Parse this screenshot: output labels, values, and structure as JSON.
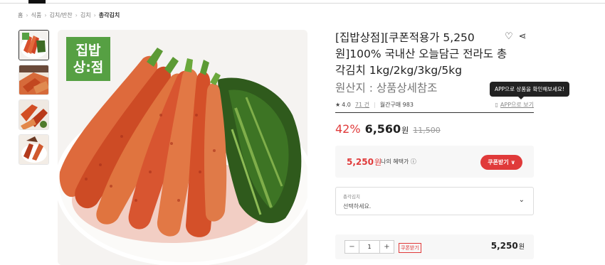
{
  "breadcrumb": [
    "홈",
    "식품",
    "김치/반찬",
    "김치",
    "총각김치"
  ],
  "brand_badge": {
    "line1": "집밥",
    "line2": "상:점"
  },
  "product": {
    "title": "[집밥상점][쿠폰적용가 5,250원]100% 국내산 오늘담근 전라도 총각김치 1kg/2kg/3kg/5kg",
    "origin": "원산지 : 상품상세참조"
  },
  "icons": {
    "wish": "heart-icon",
    "share": "share-icon",
    "star": "star-icon",
    "mobile": "mobile-icon"
  },
  "meta": {
    "rating": "4.0",
    "review_count": "71 건",
    "monthly_sales": "월간구매 983",
    "app_link": "APP으로 보기"
  },
  "tooltip": "APP으로 상품을 확인해보세요!",
  "price": {
    "discount": "42%",
    "sale": "6,560",
    "currency": "원",
    "original": "11,500"
  },
  "benefit": {
    "price": "5,250",
    "currency": "원",
    "label": "나의 혜택가 ⓘ",
    "coupon_button": "쿠폰받기 ∨"
  },
  "option_select": {
    "label": "총각김치",
    "placeholder": "선택하세요."
  },
  "quantity": {
    "minus": "−",
    "value": "1",
    "plus": "+",
    "coupon_tag": "쿠폰받기",
    "total": "5,250",
    "currency": "원"
  },
  "colors": {
    "accent": "#e03a3a",
    "brand_green": "#56a043"
  }
}
